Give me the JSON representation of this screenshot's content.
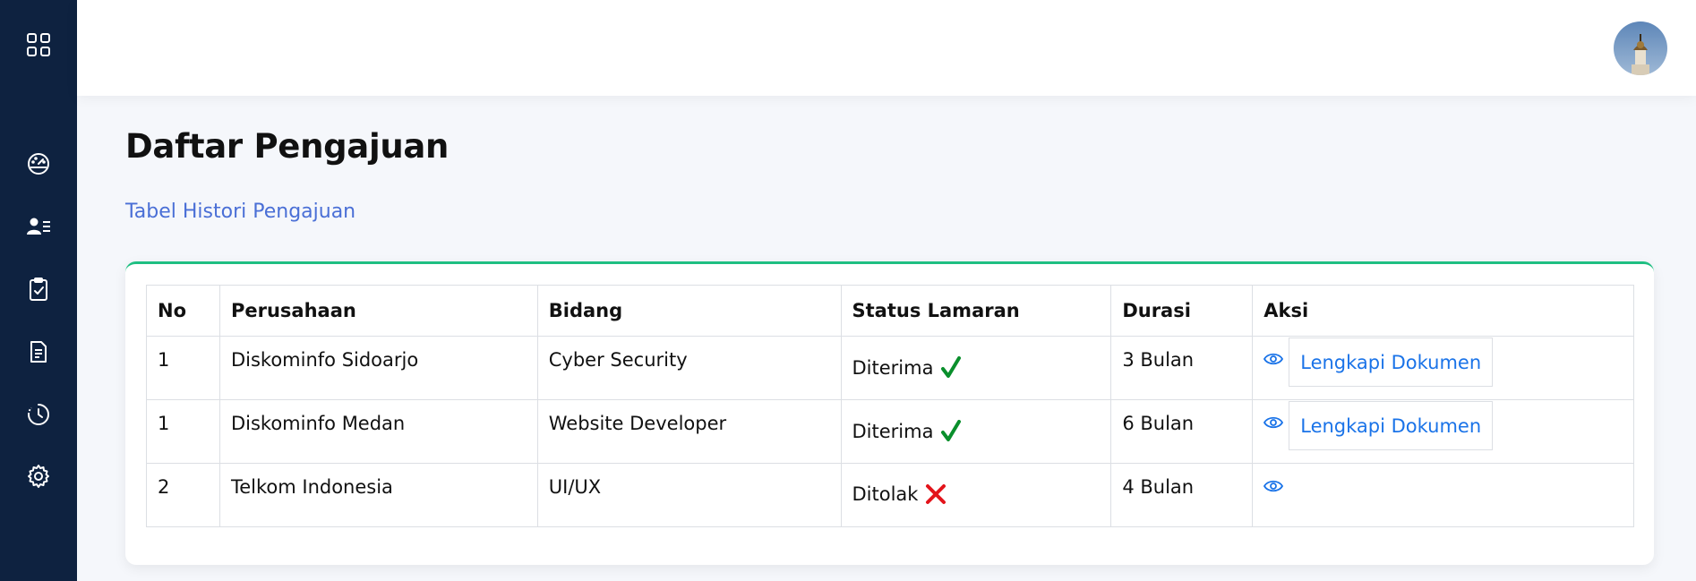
{
  "sidebar": {
    "icons": [
      "grid-icon",
      "dashboard-gauge-icon",
      "users-list-icon",
      "clipboard-check-icon",
      "document-icon",
      "history-clock-icon",
      "gear-icon"
    ]
  },
  "page": {
    "title": "Daftar Pengajuan",
    "subtitle": "Tabel Histori Pengajuan"
  },
  "table": {
    "headers": [
      "No",
      "Perusahaan",
      "Bidang",
      "Status Lamaran",
      "Durasi",
      "Aksi"
    ],
    "rows": [
      {
        "no": "1",
        "perusahaan": "Diskominfo Sidoarjo",
        "bidang": "Cyber Security",
        "status": "Diterima",
        "durasi": "3 Bulan",
        "action_label": "Lengkapi Dokumen"
      },
      {
        "no": "1",
        "perusahaan": "Diskominfo Medan",
        "bidang": "Website Developer",
        "status": "Diterima",
        "durasi": "6 Bulan",
        "action_label": "Lengkapi Dokumen"
      },
      {
        "no": "2",
        "perusahaan": "Telkom Indonesia",
        "bidang": "UI/UX",
        "status": "Ditolak",
        "durasi": "4 Bulan",
        "action_label": ""
      }
    ]
  },
  "colors": {
    "sidebar_bg": "#0e2240",
    "accent_green": "#1fbf82",
    "link_blue": "#1a73e8",
    "accepted_green": "#0a8f2c",
    "rejected_red": "#e3141b"
  },
  "status_icons": {
    "Diterima": "check-icon",
    "Ditolak": "cross-icon"
  }
}
